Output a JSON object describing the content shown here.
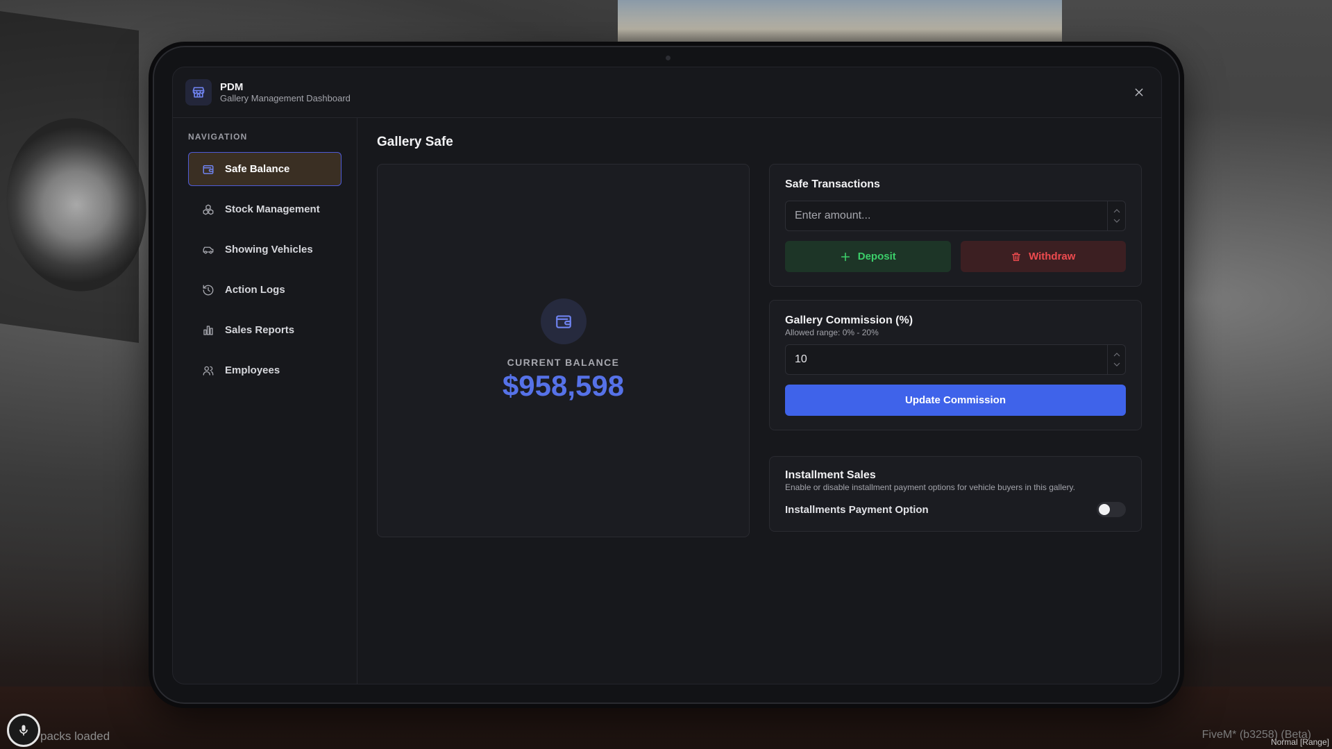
{
  "app": {
    "title": "PDM",
    "subtitle": "Gallery Management Dashboard",
    "logo_icon": "store-icon",
    "close_icon": "close-icon"
  },
  "sidebar": {
    "heading": "NAVIGATION",
    "items": [
      {
        "label": "Safe Balance",
        "icon": "wallet-icon",
        "active": true
      },
      {
        "label": "Stock Management",
        "icon": "boxes-icon",
        "active": false
      },
      {
        "label": "Showing Vehicles",
        "icon": "car-icon",
        "active": false
      },
      {
        "label": "Action Logs",
        "icon": "history-icon",
        "active": false
      },
      {
        "label": "Sales Reports",
        "icon": "bar-chart-icon",
        "active": false
      },
      {
        "label": "Employees",
        "icon": "users-icon",
        "active": false
      }
    ]
  },
  "main": {
    "title": "Gallery Safe",
    "balance": {
      "label": "CURRENT BALANCE",
      "value": "$958,598"
    },
    "transactions": {
      "title": "Safe Transactions",
      "amount_placeholder": "Enter amount...",
      "deposit_label": "Deposit",
      "withdraw_label": "Withdraw"
    },
    "commission": {
      "title": "Gallery Commission (%)",
      "subtitle": "Allowed range: 0% - 20%",
      "value": "10",
      "update_label": "Update Commission"
    },
    "installments": {
      "title": "Installment Sales",
      "subtitle": "Enable or disable installment payment options for vehicle buyers in this gallery.",
      "option_label": "Installments Payment Option",
      "enabled": false
    }
  },
  "hud": {
    "left_text": "packs loaded",
    "right_text": "FiveM* (b3258) (Beta)",
    "right_small": "Normal [Range]"
  },
  "colors": {
    "accent": "#3f63ea",
    "balance": "#5672e8",
    "deposit": "#3ccf6a",
    "withdraw": "#ee4b4f",
    "active_nav_bg": "#3a2f23"
  }
}
